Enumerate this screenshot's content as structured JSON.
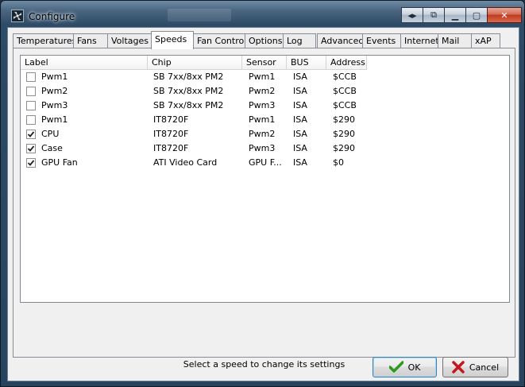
{
  "window": {
    "title": "Configure"
  },
  "tabs": [
    {
      "label": "Temperatures"
    },
    {
      "label": "Fans"
    },
    {
      "label": "Voltages"
    },
    {
      "label": "Speeds"
    },
    {
      "label": "Fan Control"
    },
    {
      "label": "Options"
    },
    {
      "label": "Log"
    },
    {
      "label": "Advanced"
    },
    {
      "label": "Events"
    },
    {
      "label": "Internet"
    },
    {
      "label": "Mail"
    },
    {
      "label": "xAP"
    }
  ],
  "active_tab": "Speeds",
  "list": {
    "columns": [
      {
        "label": "Label"
      },
      {
        "label": "Chip"
      },
      {
        "label": "Sensor"
      },
      {
        "label": "BUS"
      },
      {
        "label": "Address"
      }
    ],
    "rows": [
      {
        "checked": false,
        "label": "Pwm1",
        "chip": "SB 7xx/8xx PM2",
        "sensor": "Pwm1",
        "bus": "ISA",
        "address": "$CCB"
      },
      {
        "checked": false,
        "label": "Pwm2",
        "chip": "SB 7xx/8xx PM2",
        "sensor": "Pwm2",
        "bus": "ISA",
        "address": "$CCB"
      },
      {
        "checked": false,
        "label": "Pwm3",
        "chip": "SB 7xx/8xx PM2",
        "sensor": "Pwm3",
        "bus": "ISA",
        "address": "$CCB"
      },
      {
        "checked": false,
        "label": "Pwm1",
        "chip": "IT8720F",
        "sensor": "Pwm1",
        "bus": "ISA",
        "address": "$290"
      },
      {
        "checked": true,
        "label": "CPU",
        "chip": "IT8720F",
        "sensor": "Pwm2",
        "bus": "ISA",
        "address": "$290"
      },
      {
        "checked": true,
        "label": "Case",
        "chip": "IT8720F",
        "sensor": "Pwm3",
        "bus": "ISA",
        "address": "$290"
      },
      {
        "checked": true,
        "label": "GPU Fan",
        "chip": "ATI Video Card",
        "sensor": "GPU F...",
        "bus": "ISA",
        "address": "$0"
      }
    ]
  },
  "status_text": "Select a speed to change its settings",
  "buttons": {
    "ok": "OK",
    "cancel": "Cancel"
  },
  "icons": {
    "app": "fan-app-icon",
    "ok": "green-checkmark-icon",
    "cancel": "red-x-icon"
  },
  "colors": {
    "ok_check": "#2e9a1d",
    "cancel_x": "#c4171d"
  }
}
